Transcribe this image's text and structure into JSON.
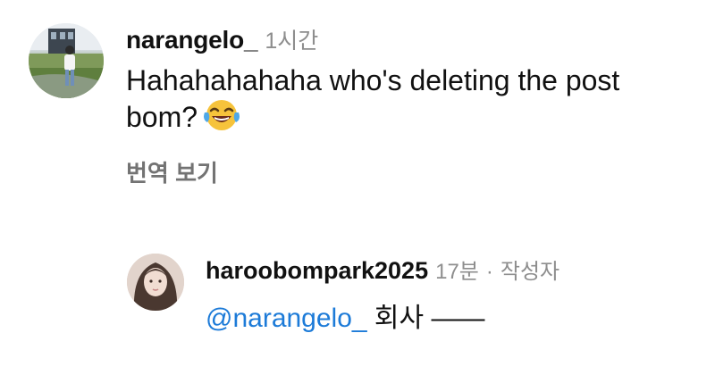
{
  "comments": [
    {
      "username": "narangelo_",
      "timestamp": "1시간",
      "text_line1": "Hahahahahaha who's deleting the post",
      "text_line2": "bom?",
      "emoji": "face-with-tears-of-joy",
      "translate_label": "번역 보기"
    }
  ],
  "reply": {
    "username": "haroobompark2025",
    "timestamp": "17분",
    "separator": "·",
    "author_tag": "작성자",
    "mention": "@narangelo_",
    "text": " 회사 ——"
  },
  "colors": {
    "mention": "#1d7bd8",
    "muted": "#8e8e8e"
  }
}
